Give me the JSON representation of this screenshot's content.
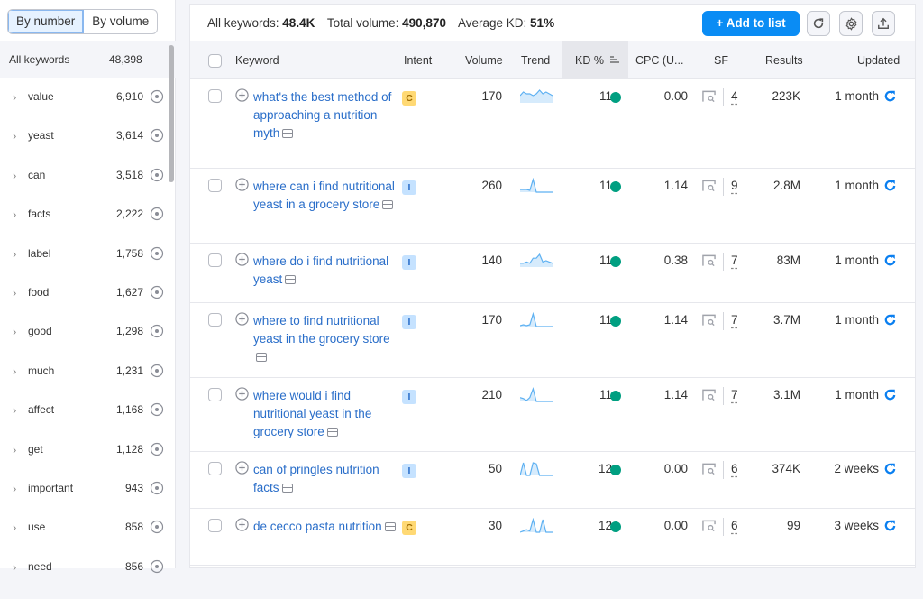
{
  "left_panel": {
    "toggle": {
      "by_number": "By number",
      "by_volume": "By volume",
      "selected": "By number"
    },
    "all_keywords": {
      "label": "All keywords",
      "count": "48,398"
    },
    "groups": [
      {
        "name": "value",
        "count": "6,910"
      },
      {
        "name": "yeast",
        "count": "3,614"
      },
      {
        "name": "can",
        "count": "3,518"
      },
      {
        "name": "facts",
        "count": "2,222"
      },
      {
        "name": "label",
        "count": "1,758"
      },
      {
        "name": "food",
        "count": "1,627"
      },
      {
        "name": "good",
        "count": "1,298"
      },
      {
        "name": "much",
        "count": "1,231"
      },
      {
        "name": "affect",
        "count": "1,168"
      },
      {
        "name": "get",
        "count": "1,128"
      },
      {
        "name": "important",
        "count": "943"
      },
      {
        "name": "use",
        "count": "858"
      },
      {
        "name": "need",
        "count": "856"
      }
    ]
  },
  "summary": {
    "all_keywords_label": "All keywords:",
    "all_keywords_value": "48.4K",
    "total_volume_label": "Total volume:",
    "total_volume_value": "490,870",
    "avg_kd_label": "Average KD:",
    "avg_kd_value": "51%"
  },
  "toolbar": {
    "add_to_list": "+  Add to list",
    "icons": [
      "refresh-icon",
      "settings-icon",
      "export-icon"
    ]
  },
  "table": {
    "columns": [
      "Keyword",
      "Intent",
      "Volume",
      "Trend",
      "KD %",
      "CPC (U...",
      "SF",
      "Results",
      "Updated"
    ],
    "sorted_column": "KD %",
    "rows": [
      {
        "keyword": "what's the best method of approaching a nutrition myth",
        "intent": "C",
        "volume": "170",
        "trend": [
          4,
          6,
          5,
          5,
          4,
          5,
          7,
          5,
          6,
          5,
          4
        ],
        "kd": "11",
        "cpc": "0.00",
        "sf": "4",
        "results": "223K",
        "updated": "1 month"
      },
      {
        "keyword": "where can i find nutritional yeast in a grocery store",
        "intent": "I",
        "volume": "260",
        "trend": [
          3,
          3,
          3,
          2,
          14,
          0,
          0,
          0,
          0,
          0,
          0
        ],
        "kd": "11",
        "cpc": "1.14",
        "sf": "9",
        "results": "2.8M",
        "updated": "1 month"
      },
      {
        "keyword": "where do i find nutritional yeast",
        "intent": "I",
        "volume": "140",
        "trend": [
          3,
          3,
          4,
          3,
          7,
          7,
          10,
          4,
          5,
          4,
          3
        ],
        "kd": "11",
        "cpc": "0.38",
        "sf": "7",
        "results": "83M",
        "updated": "1 month"
      },
      {
        "keyword": "where to find nutritional yeast in the grocery store",
        "intent": "I",
        "volume": "170",
        "trend": [
          1,
          2,
          1,
          2,
          14,
          0,
          0,
          0,
          0,
          0,
          0
        ],
        "kd": "11",
        "cpc": "1.14",
        "sf": "7",
        "results": "3.7M",
        "updated": "1 month"
      },
      {
        "keyword": "where would i find nutritional yeast in the grocery store",
        "intent": "I",
        "volume": "210",
        "trend": [
          4,
          3,
          1,
          4,
          13,
          0,
          0,
          0,
          0,
          0,
          0
        ],
        "kd": "11",
        "cpc": "1.14",
        "sf": "7",
        "results": "3.1M",
        "updated": "1 month"
      },
      {
        "keyword": "can of pringles nutrition facts",
        "intent": "I",
        "volume": "50",
        "trend": [
          0,
          12,
          0,
          0,
          12,
          11,
          0,
          0,
          0,
          0,
          0
        ],
        "kd": "12",
        "cpc": "0.00",
        "sf": "6",
        "results": "374K",
        "updated": "2 weeks"
      },
      {
        "keyword": "de cecco pasta nutrition",
        "intent": "C",
        "volume": "30",
        "trend": [
          0,
          1,
          2,
          1,
          10,
          0,
          0,
          10,
          0,
          0,
          0
        ],
        "kd": "12",
        "cpc": "0.00",
        "sf": "6",
        "results": "99",
        "updated": "3 weeks"
      }
    ]
  },
  "colors": {
    "accent": "#0a8cf4",
    "link": "#2a6ec9",
    "kd_easy": "#009f81",
    "intent_commercial": "#ffd974",
    "intent_informational": "#c5e2ff"
  }
}
